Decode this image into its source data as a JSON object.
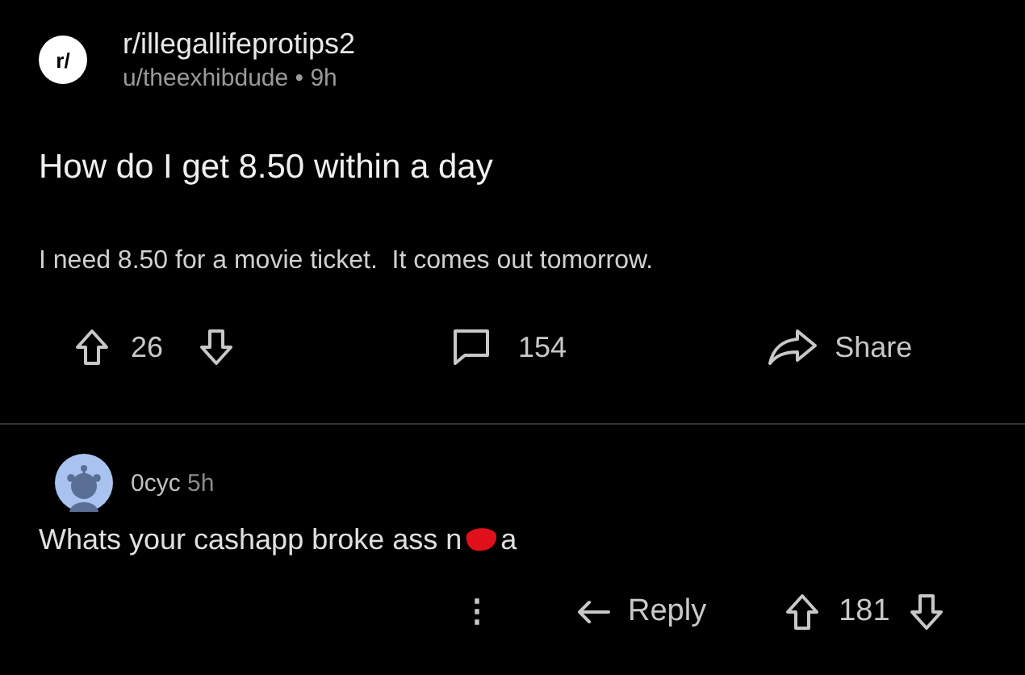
{
  "post": {
    "icon_text": "r/",
    "subreddit": "r/illegallifeprotips2",
    "author": "u/theexhibdude",
    "separator": "•",
    "age": "9h",
    "title": "How do I get 8.50 within a day",
    "body": "I need 8.50 for a movie ticket.  It comes out tomorrow.",
    "votes": "26",
    "comments": "154",
    "share": "Share"
  },
  "comment": {
    "author": "0cyc",
    "age": "5h",
    "text_before": "Whats your cashapp broke ass n",
    "redacted": true,
    "text_after": "a",
    "more": "⋮",
    "reply": "Reply",
    "votes": "181"
  }
}
